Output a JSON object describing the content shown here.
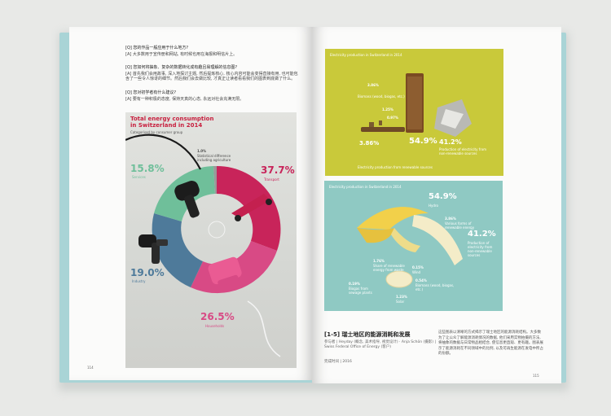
{
  "left_page": {
    "qa": [
      {
        "q": "[Q] 您的作品一般应用于什么地方?",
        "a": "[A] 大多数用于宣传册和网站, 有时候也用在海报和明信片上。"
      },
      {
        "q": "[Q] 您如何将抽象、复杂的数据转化成有趣且易理解的信息图?",
        "a": "[A] 首先我们会用故事, 深入地探讨主题, 然后提炼核心, 核心内容可能会变得直接有用, 也可能包含了一些令人惊讶的细节。然后我们会去做比较, 才真正让读者看看我们的图表到底做了什么。"
      },
      {
        "q": "[Q] 您对初学者有什么建议?",
        "a": "[A] 要有一种积极的态度, 保持天真的心态, 永远对社会充满无限。"
      }
    ],
    "chart": {
      "title_line1": "Total energy consumption",
      "title_line2": "in Switzerland in 2014",
      "subtitle": "Categorised by consumer group",
      "segments": [
        {
          "pct": "37.7%",
          "label": "Transport",
          "color": "#c8245a"
        },
        {
          "pct": "26.5%",
          "label": "Households",
          "color": "#d84a85"
        },
        {
          "pct": "19.0%",
          "label": "Industry",
          "color": "#4e7a9a"
        },
        {
          "pct": "15.8%",
          "label": "Services",
          "color": "#6fbf9a"
        },
        {
          "pct": "1.0%",
          "label": "Statistical difference including agriculture",
          "color": "#999999"
        }
      ]
    },
    "page_number": "114"
  },
  "right_page": {
    "top_image": {
      "title": "Electricity production in Switzerland in 2014",
      "stats": [
        {
          "pct": "3.86%",
          "label": "Biomass (wood, biogas, etc.)"
        },
        {
          "pct": "1.25%",
          "label": "Waste"
        },
        {
          "pct": "0.97%",
          "label": "Wind"
        },
        {
          "pct": "54.9%",
          "label": "Hydro"
        },
        {
          "pct": "41.2%",
          "label": "Production of electricity from non-renewable sources"
        },
        {
          "pct": "3.86%",
          "label": "Renewable"
        }
      ],
      "footer": "Electricity production from renewable sources"
    },
    "bottom_image": {
      "title": "Electricity production in Switzerland in 2014",
      "stats": [
        {
          "pct": "54.9%",
          "label": "Hydro"
        },
        {
          "pct": "3.86%",
          "label": "Various forms of renewable energy"
        },
        {
          "pct": "41.2%",
          "label": "Production of electricity from non-renewable sources"
        },
        {
          "pct": "1.76%",
          "label": "Share of renewable energy from waste"
        },
        {
          "pct": "0.15%",
          "label": "Wind"
        },
        {
          "pct": "0.54%",
          "label": "Biomass (wood, biogas, etc.)"
        },
        {
          "pct": "0.19%",
          "label": "Biogas from sewage plants"
        },
        {
          "pct": "1.23%",
          "label": "Solar"
        }
      ]
    },
    "caption": {
      "title": "[1-5] 瑞士地区的能源消耗和发展",
      "credits": "参与者 | Heyday (概念, 美术指导, 视觉设计) · Anja Schön (摄影) | Swiss Federal Office of Energy (客户)",
      "date": "完成时间 | 2016"
    },
    "body": "这些图表以清晰的方式揭示了瑞士地区的能源消耗结构。大多数为了让公众了解能源消耗情况的数据, 他们采用实物拍摄的方法, 将抽象的数据与日常物品相结合, 使信息更直观、更有趣。图表展示了能源消耗在不同领域中的比例, 以及可再生能源在发电中所占的份额。",
    "page_number": "115"
  }
}
